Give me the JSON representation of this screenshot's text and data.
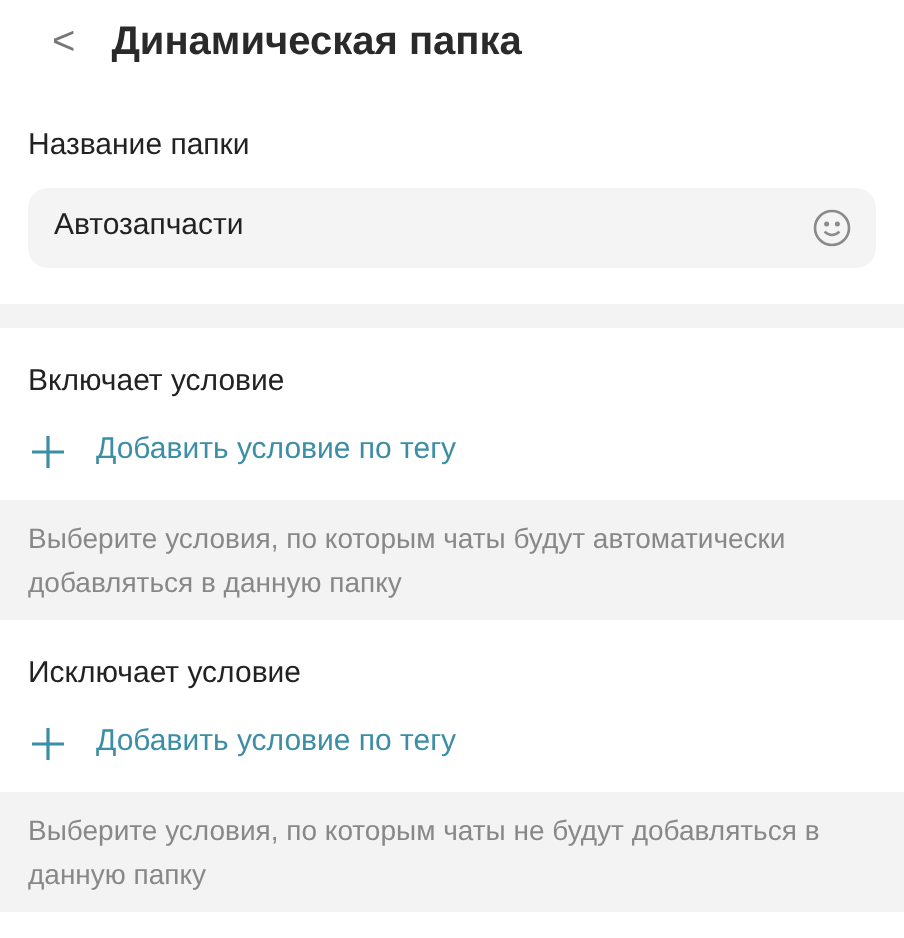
{
  "header": {
    "back": "<",
    "title": "Динамическая папка"
  },
  "folder_name": {
    "label": "Название папки",
    "value": "Автозапчасти"
  },
  "sections": [
    {
      "title": "Включает условие",
      "add": "Добавить условие по тегу",
      "hint": "Выберите условия, по которым чаты будут автоматически добавляться в данную папку"
    },
    {
      "title": "Исключает условие",
      "add": "Добавить условие по тегу",
      "hint": "Выберите условия, по которым чаты не будут добавляться в данную папку"
    }
  ]
}
